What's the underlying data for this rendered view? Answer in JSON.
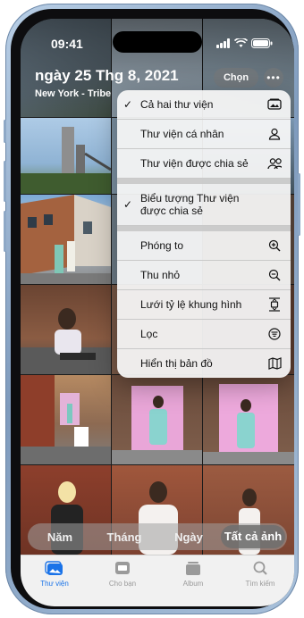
{
  "status_bar": {
    "time": "09:41"
  },
  "header": {
    "date_title": "ngày 25 Thg 8, 2021",
    "location": "New York - Tribe",
    "select_label": "Chọn",
    "more_label": "•••"
  },
  "menu": {
    "items": [
      {
        "label": "Cả hai thư viện",
        "checked": true,
        "icon": "photos-library-icon"
      },
      {
        "label": "Thư viện cá nhân",
        "checked": false,
        "icon": "person-icon"
      },
      {
        "label": "Thư viện được chia sẻ",
        "checked": false,
        "icon": "two-people-icon"
      },
      {
        "label": "Biểu tượng Thư viện được chia sẻ",
        "checked": true,
        "icon": ""
      },
      {
        "label": "Phóng to",
        "checked": false,
        "icon": "zoom-in-icon"
      },
      {
        "label": "Thu nhỏ",
        "checked": false,
        "icon": "zoom-out-icon"
      },
      {
        "label": "Lưới tỷ lệ khung hình",
        "checked": false,
        "icon": "aspect-ratio-icon"
      },
      {
        "label": "Lọc",
        "checked": false,
        "icon": "filter-icon"
      },
      {
        "label": "Hiển thị bản đồ",
        "checked": false,
        "icon": "map-icon"
      }
    ],
    "check_mark": "✓"
  },
  "segmented": {
    "items": [
      "Năm",
      "Tháng",
      "Ngày",
      "Tất cả ảnh"
    ],
    "active_index": 3
  },
  "tabbar": {
    "items": [
      {
        "label": "Thư viện",
        "icon": "photo-library-tab-icon",
        "active": true
      },
      {
        "label": "Cho bạn",
        "icon": "for-you-tab-icon",
        "active": false
      },
      {
        "label": "Album",
        "icon": "albums-tab-icon",
        "active": false
      },
      {
        "label": "Tìm kiếm",
        "icon": "search-tab-icon",
        "active": false
      }
    ]
  },
  "colors": {
    "accent": "#1a73e8",
    "menu_bg": "#f5f5f5"
  }
}
